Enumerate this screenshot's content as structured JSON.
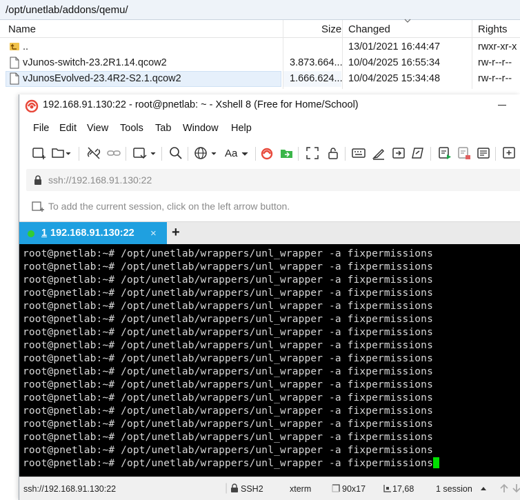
{
  "file_browser": {
    "path": "/opt/unetlab/addons/qemu/",
    "columns": {
      "name": "Name",
      "size": "Size",
      "changed": "Changed",
      "rights": "Rights"
    },
    "rows": [
      {
        "name": "..",
        "size": "",
        "changed": "13/01/2021 16:44:47",
        "rights": "rwxr-xr-x",
        "icon": "parent-dir-icon"
      },
      {
        "name": "vJunos-switch-23.2R1.14.qcow2",
        "size": "3.873.664...",
        "changed": "10/04/2025 16:55:34",
        "rights": "rw-r--r--",
        "icon": "file-icon"
      },
      {
        "name": "vJunosEvolved-23.4R2-S2.1.qcow2",
        "size": "1.666.624...",
        "changed": "10/04/2025 15:34:48",
        "rights": "rw-r--r--",
        "icon": "file-icon",
        "selected": true
      }
    ]
  },
  "xshell": {
    "title": "192.168.91.130:22 - root@pnetlab: ~ - Xshell 8 (Free for Home/School)",
    "menu": [
      "File",
      "Edit",
      "View",
      "Tools",
      "Tab",
      "Window",
      "Help"
    ],
    "toolbar_icons": [
      "new-session-icon",
      "open-folder-icon",
      "disconnect-icon",
      "reconnect-icon",
      "new-window-icon",
      "find-icon",
      "globe-icon",
      "font-icon",
      "xshell-icon",
      "xftp-icon",
      "fullscreen-icon",
      "lock-icon",
      "keyboard-icon",
      "script-icon",
      "transfer-icon",
      "compose-icon",
      "log-icon",
      "print-icon",
      "highlight-icon",
      "add-icon"
    ],
    "font_button": "Aa",
    "address": "ssh://192.168.91.130:22",
    "hint": "To add the current session, click on the left arrow button.",
    "tab": {
      "number": "1",
      "label": "192.168.91.130:22",
      "close": "×",
      "add": "+"
    },
    "terminal": {
      "prompt": "root@pnetlab:~# ",
      "command": "/opt/unetlab/wrappers/unl_wrapper -a fixpermissions",
      "line_count": 17
    },
    "status": {
      "address": "ssh://192.168.91.130:22",
      "protocol": "SSH2",
      "term": "xterm",
      "size": "90x17",
      "cursor": "17,68",
      "sessions": "1 session"
    },
    "colors": {
      "tab_active": "#1fa0e0",
      "cursor": "#00e000",
      "terminal_bg": "#000000"
    }
  }
}
